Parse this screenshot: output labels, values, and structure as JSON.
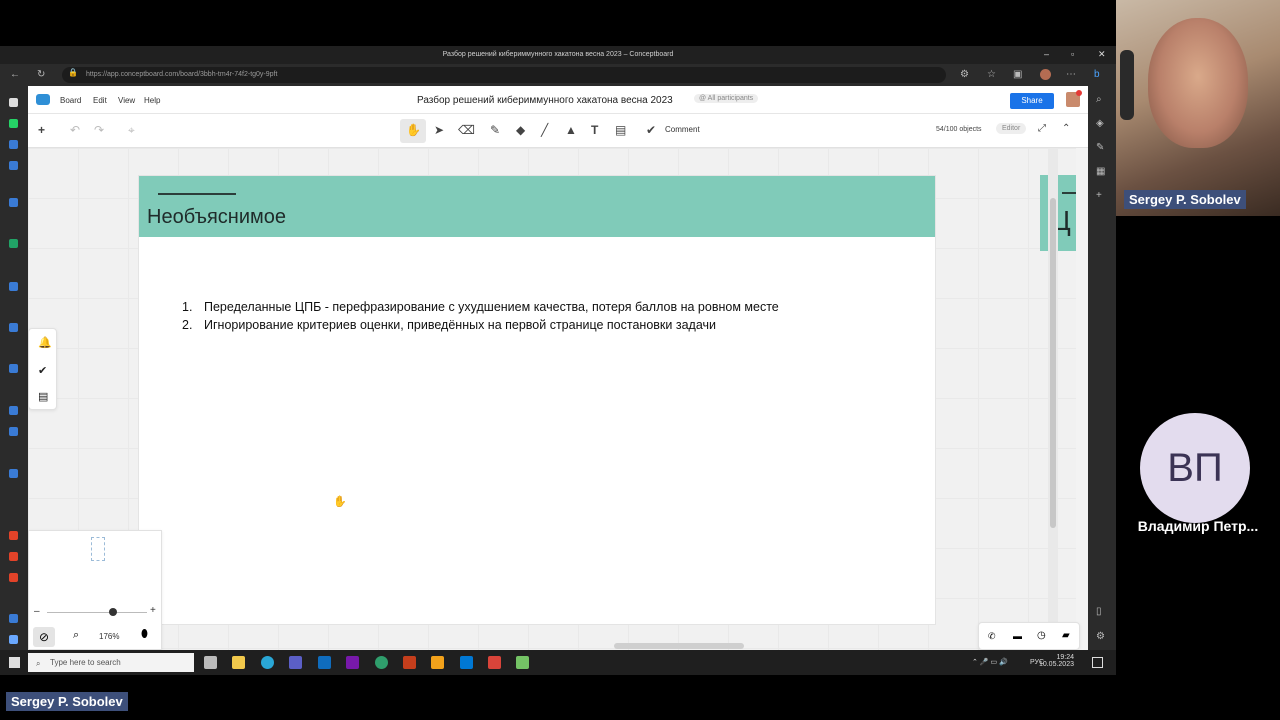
{
  "browser": {
    "window_title": "Разбор решений кибериммунного хакатона весна 2023 – Conceptboard",
    "url": "https://app.conceptboard.com/board/3bbh-tm4r-74f2-tg0y-9pft"
  },
  "app": {
    "menu": [
      "Board",
      "Edit",
      "View",
      "Help"
    ],
    "board_title": "Разбор решений кибериммунного хакатона весна 2023",
    "participants_label": "@ All participants",
    "share_label": "Share",
    "comment_label": "Comment",
    "objects_count": "54/100 objects",
    "role_label": "Editor",
    "zoom_level": "176%"
  },
  "slide": {
    "title": "Необъяснимое",
    "items": [
      {
        "num": "1.",
        "text": "Переделанные ЦПБ - перефразирование  с ухудшением качества, потеря баллов на ровном месте"
      },
      {
        "num": "2.",
        "text": "Игнорирование критериев оценки, приведённых на первой странице постановки задачи"
      }
    ],
    "next_slide_partial": "Ц"
  },
  "taskbar": {
    "search_placeholder": "Type here to search",
    "tray_lang": "РУС",
    "time": "19:24",
    "date": "10.05.2023"
  },
  "participants": {
    "speaker_name": "Sergey P. Sobolev",
    "second_name": "Владимир Петр...",
    "second_initials": "ВП",
    "bottom_label": "Sergey P. Sobolev"
  },
  "colors": {
    "slide_header": "#80cbb9",
    "share_button": "#1a73e8",
    "nametag": "#3d4f7a"
  }
}
